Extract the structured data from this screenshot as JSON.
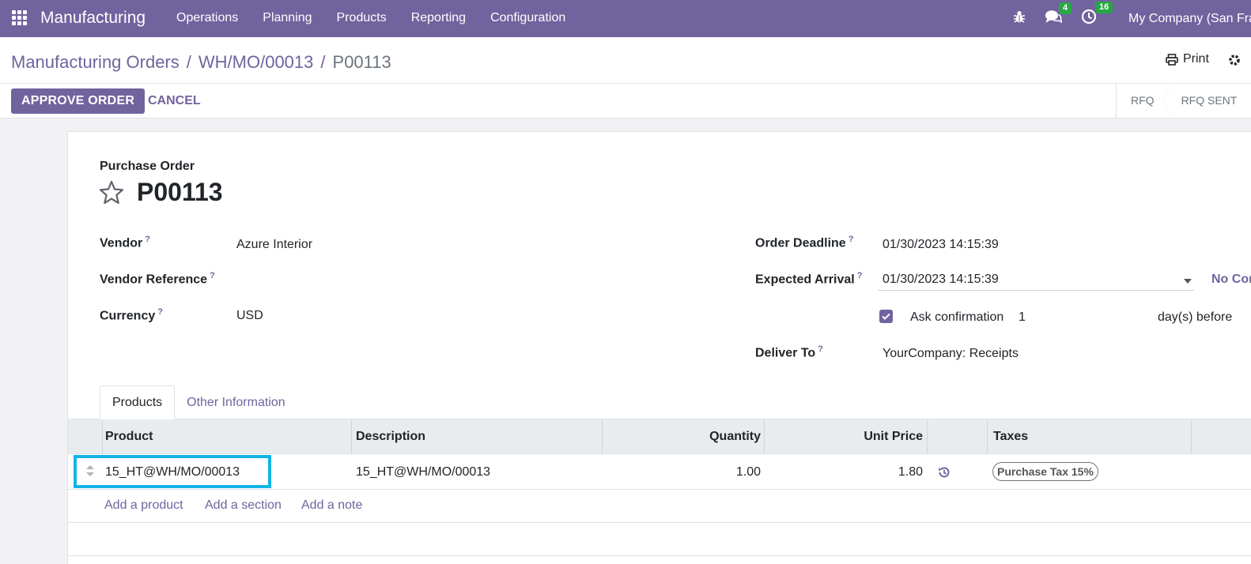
{
  "navbar": {
    "app_name": "Manufacturing",
    "menu": [
      "Operations",
      "Planning",
      "Products",
      "Reporting",
      "Configuration"
    ],
    "messages_count": "4",
    "activities_count": "16",
    "company": "My Company (San Francisco)"
  },
  "control_panel": {
    "breadcrumb": [
      "Manufacturing Orders",
      "WH/MO/00013",
      "P00113"
    ],
    "print_label": "Print",
    "approve_label": "APPROVE ORDER",
    "cancel_label": "CANCEL",
    "status_steps": [
      "RFQ",
      "RFQ SENT"
    ]
  },
  "form": {
    "doc_type": "Purchase Order",
    "doc_name": "P00113",
    "help_mark": "?",
    "vendor_label": "Vendor",
    "vendor_value": "Azure Interior",
    "vendor_ref_label": "Vendor Reference",
    "vendor_ref_value": "",
    "currency_label": "Currency",
    "currency_value": "USD",
    "order_deadline_label": "Order Deadline",
    "order_deadline_value": "01/30/2023 14:15:39",
    "expected_arrival_label": "Expected Arrival",
    "expected_arrival_value": "01/30/2023 14:15:39",
    "expected_arrival_side_link": "No Confirmation",
    "ask_confirmation_label": "Ask confirmation",
    "ask_confirmation_days": "1",
    "ask_confirmation_suffix": "day(s) before",
    "deliver_to_label": "Deliver To",
    "deliver_to_value": "YourCompany: Receipts"
  },
  "tabs": [
    "Products",
    "Other Information"
  ],
  "table": {
    "headers": [
      "Product",
      "Description",
      "Quantity",
      "Unit Price",
      "Taxes"
    ],
    "rows": [
      {
        "product": "15_HT@WH/MO/00013",
        "description": "15_HT@WH/MO/00013",
        "quantity": "1.00",
        "unit_price": "1.80",
        "taxes": "Purchase Tax 15%"
      }
    ],
    "add_links": [
      "Add a product",
      "Add a section",
      "Add a note"
    ]
  },
  "colors": {
    "brand": "#71639e",
    "badge": "#28a745",
    "highlight": "#12b4e6"
  }
}
